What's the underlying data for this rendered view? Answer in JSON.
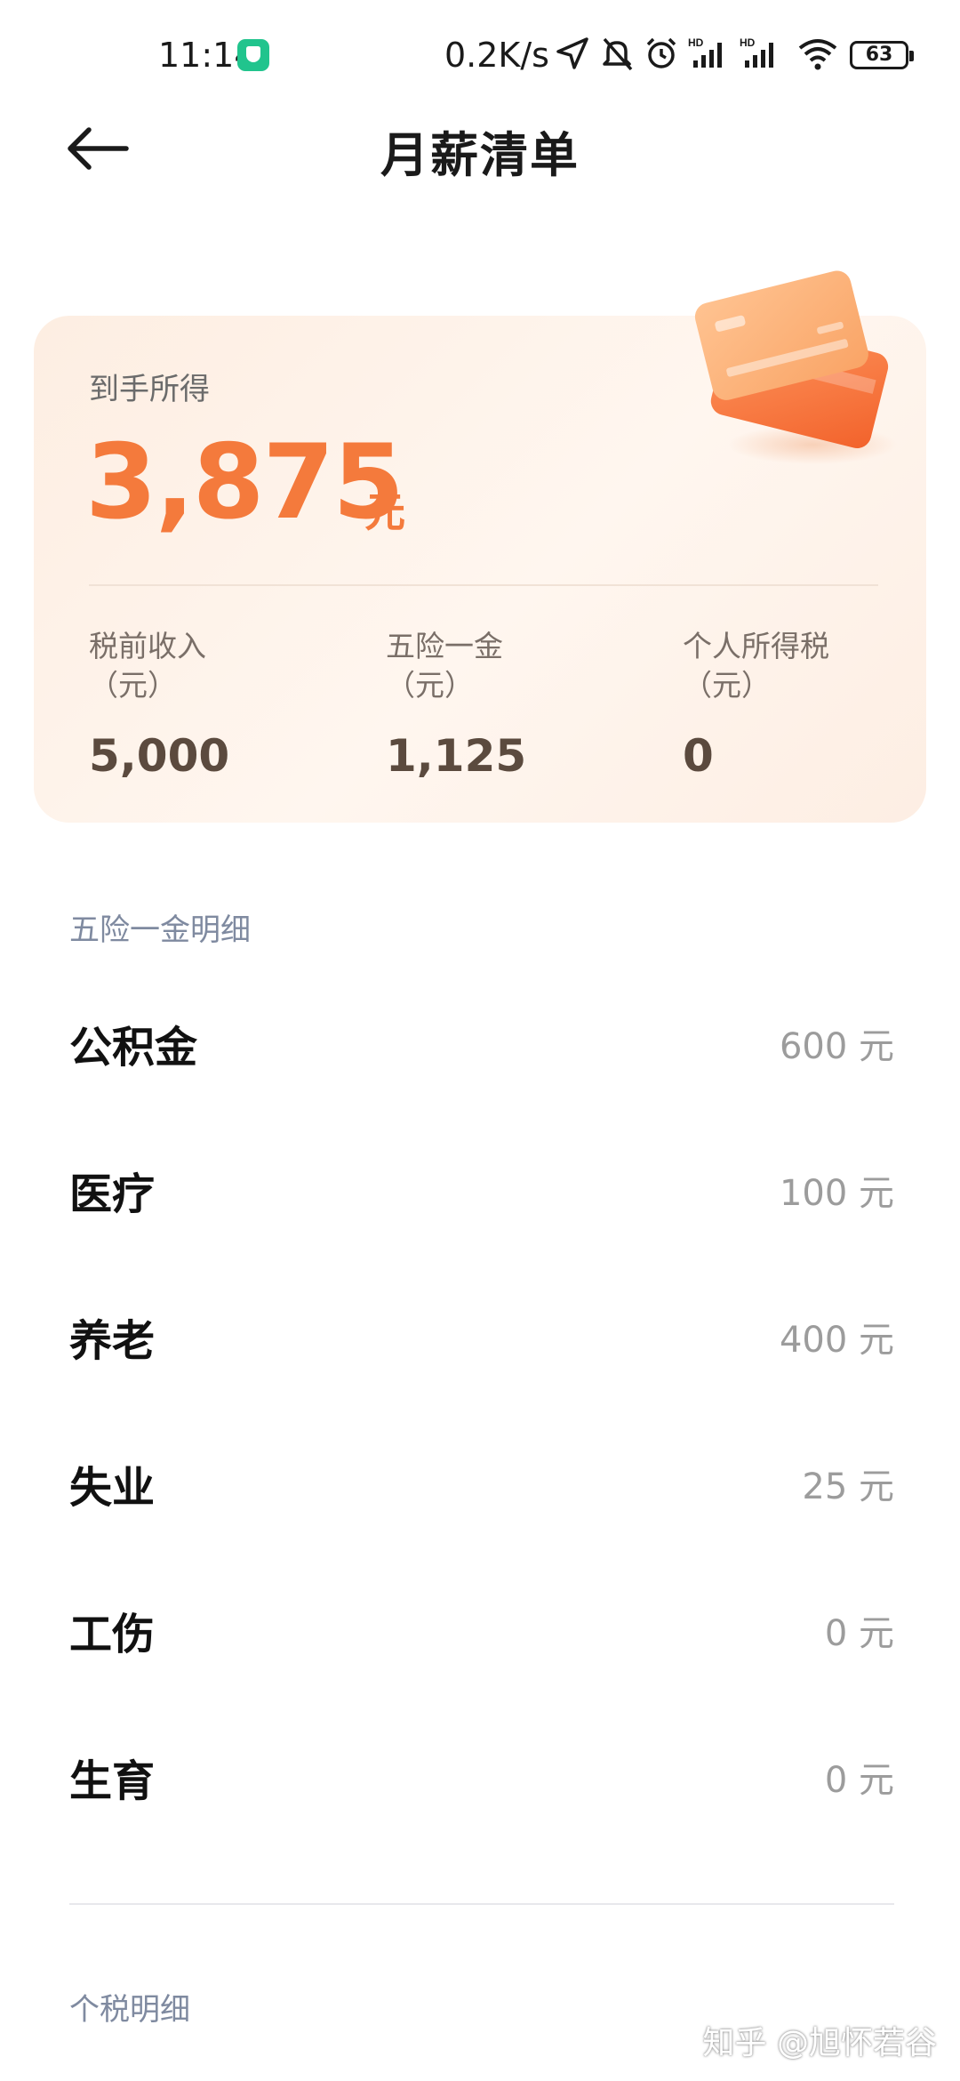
{
  "status_bar": {
    "time": "11:14",
    "network_speed": "0.2K/s",
    "battery": "63",
    "icons": [
      "shield-icon",
      "location-arrow-icon",
      "bell-off-icon",
      "alarm-icon",
      "hd-signal-icon",
      "hd-signal-icon",
      "wifi-icon",
      "battery-icon"
    ]
  },
  "header": {
    "title": "月薪清单",
    "back_icon": "arrow-left-icon"
  },
  "summary": {
    "net_label": "到手所得",
    "net_amount": "3,875",
    "net_unit": "元",
    "metrics": [
      {
        "label": "税前收入",
        "unit": "（元）",
        "value": "5,000"
      },
      {
        "label": "五险一金",
        "unit": "（元）",
        "value": "1,125"
      },
      {
        "label": "个人所得税",
        "unit": "（元）",
        "value": "0"
      }
    ],
    "accent_color": "#f47a3c"
  },
  "insurance_section": {
    "title": "五险一金明细",
    "items": [
      {
        "label": "公积金",
        "value": "600 元"
      },
      {
        "label": "医疗",
        "value": "100 元"
      },
      {
        "label": "养老",
        "value": "400 元"
      },
      {
        "label": "失业",
        "value": "25 元"
      },
      {
        "label": "工伤",
        "value": "0 元"
      },
      {
        "label": "生育",
        "value": "0 元"
      }
    ]
  },
  "tax_section": {
    "title": "个税明细"
  },
  "watermark": "知乎 @旭怀若谷"
}
